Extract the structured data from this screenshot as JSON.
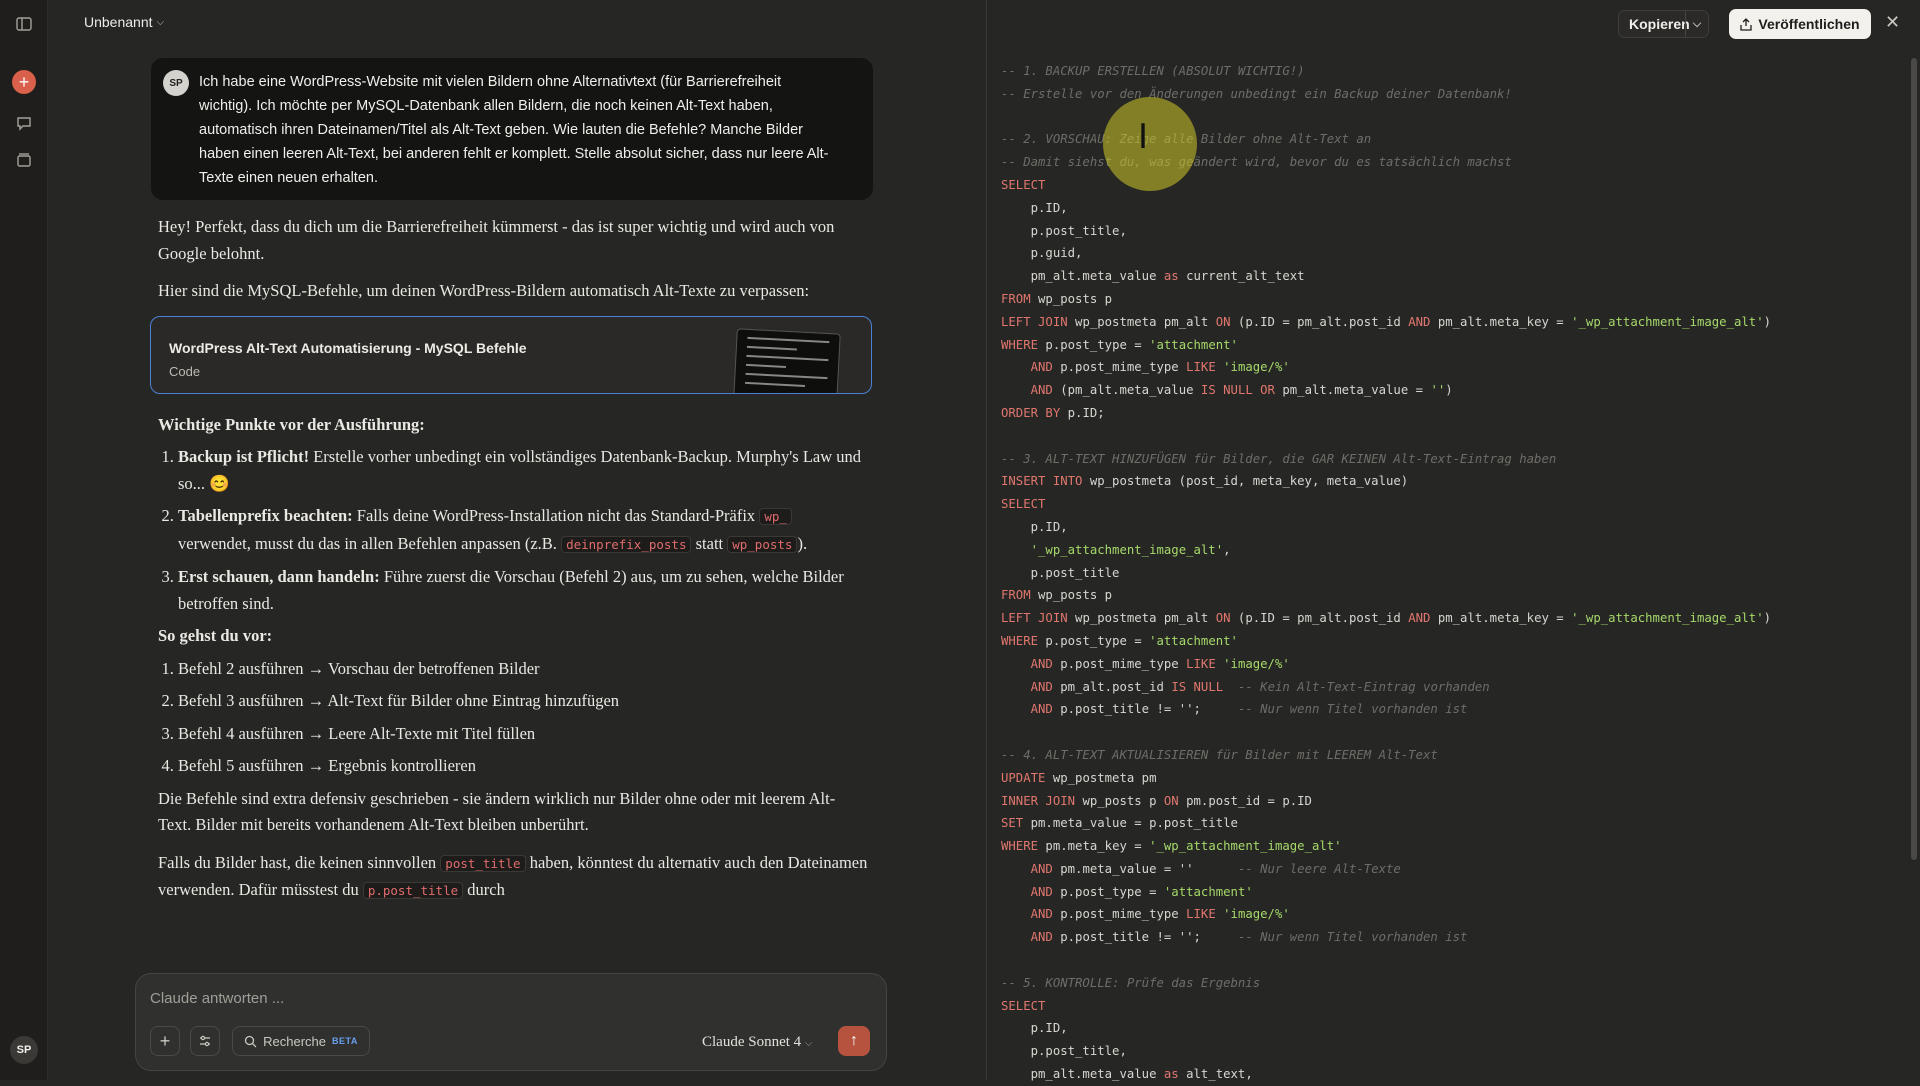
{
  "sidebar": {
    "icons": [
      "sidebar-toggle-icon",
      "new-chat-icon",
      "search-icon",
      "projects-icon"
    ],
    "avatar_initials": "SP"
  },
  "chat": {
    "title": "Unbenannt",
    "user": {
      "initials": "SP",
      "message": "Ich habe eine WordPress-Website mit vielen Bildern ohne Alternativtext (für Barrierefreiheit wichtig). Ich möchte per MySQL-Datenbank allen Bildern, die noch keinen Alt-Text haben, automatisch ihren Dateinamen/Titel als Alt-Text geben. Wie lauten die Befehle? Manche Bilder haben einen leeren Alt-Text, bei anderen fehlt er komplett. Stelle absolut sicher, dass nur leere Alt-Texte einen neuen erhalten."
    },
    "assistant": {
      "p1": "Hey! Perfekt, dass du dich um die Barrierefreiheit kümmerst - das ist super wichtig und wird auch von Google belohnt.",
      "p2": "Hier sind die MySQL-Befehle, um deinen WordPress-Bildern automatisch Alt-Texte zu verpassen:",
      "artifact": {
        "title": "WordPress Alt-Text Automatisierung - MySQL Befehle",
        "kind": "Code"
      },
      "h_points": "Wichtige Punkte vor der Ausführung:",
      "point1_strong": "Backup ist Pflicht!",
      "point1_text": " Erstelle vorher unbedingt ein vollständiges Datenbank-Backup. Murphy's Law und so... 😊",
      "point2_strong": "Tabellenprefix beachten:",
      "point2_a": " Falls deine WordPress-Installation nicht das Standard-Präfix ",
      "point2_code1": "wp_",
      "point2_b": " verwendet, musst du das in allen Befehlen anpassen (z.B. ",
      "point2_code2": "deinprefix_posts",
      "point2_c": " statt ",
      "point2_code3": "wp_posts",
      "point2_d": ").",
      "point3_strong": "Erst schauen, dann handeln:",
      "point3_text": " Führe zuerst die Vorschau (Befehl 2) aus, um zu sehen, welche Bilder betroffen sind.",
      "h_steps": "So gehst du vor:",
      "steps": [
        "Befehl 2 ausführen → Vorschau der betroffenen Bilder",
        "Befehl 3 ausführen → Alt-Text für Bilder ohne Eintrag hinzufügen",
        "Befehl 4 ausführen → Leere Alt-Texte mit Titel füllen",
        "Befehl 5 ausführen → Ergebnis kontrollieren"
      ],
      "p3": "Die Befehle sind extra defensiv geschrieben - sie ändern wirklich nur Bilder ohne oder mit leerem Alt-Text. Bilder mit bereits vorhandenem Alt-Text bleiben unberührt.",
      "p4_a": "Falls du Bilder hast, die keinen sinnvollen ",
      "p4_code1": "post_title",
      "p4_b": " haben, könntest du alternativ auch den Dateinamen verwenden. Dafür müsstest du ",
      "p4_code2": "p.post_title",
      "p4_c": " durch"
    }
  },
  "composer": {
    "placeholder": "Claude antworten ...",
    "research_label": "Recherche",
    "beta_label": "BETA",
    "model": "Claude Sonnet 4"
  },
  "panel": {
    "copy_label": "Kopieren",
    "publish_label": "Veröffentlichen",
    "code_lines": [
      [
        [
          "cm",
          "-- 1. BACKUP ERSTELLEN (ABSOLUT WICHTIG!)"
        ]
      ],
      [
        [
          "cm",
          "-- Erstelle vor den Änderungen unbedingt ein Backup deiner Datenbank!"
        ]
      ],
      [],
      [
        [
          "cm",
          "-- 2. VORSCHAU: Zeige alle Bilder ohne Alt-Text an"
        ]
      ],
      [
        [
          "cm",
          "-- Damit siehst du, was geändert wird, bevor du es tatsächlich machst"
        ]
      ],
      [
        [
          "kw",
          "SELECT"
        ]
      ],
      [
        [
          "",
          "    p.ID,"
        ]
      ],
      [
        [
          "",
          "    p.post_title,"
        ]
      ],
      [
        [
          "",
          "    p.guid,"
        ]
      ],
      [
        [
          "",
          "    pm_alt.meta_value "
        ],
        [
          "kw",
          "as"
        ],
        [
          "",
          " current_alt_text"
        ]
      ],
      [
        [
          "kw",
          "FROM"
        ],
        [
          "",
          " wp_posts p"
        ]
      ],
      [
        [
          "kw",
          "LEFT JOIN"
        ],
        [
          "",
          " wp_postmeta pm_alt "
        ],
        [
          "kw",
          "ON"
        ],
        [
          "",
          " (p.ID = pm_alt.post_id "
        ],
        [
          "kw",
          "AND"
        ],
        [
          "",
          " pm_alt.meta_key = "
        ],
        [
          "st",
          "'_wp_attachment_image_alt'"
        ],
        [
          "",
          ")"
        ]
      ],
      [
        [
          "kw",
          "WHERE"
        ],
        [
          "",
          " p.post_type = "
        ],
        [
          "st",
          "'attachment'"
        ]
      ],
      [
        [
          "",
          "    "
        ],
        [
          "kw",
          "AND"
        ],
        [
          "",
          " p.post_mime_type "
        ],
        [
          "kw",
          "LIKE"
        ],
        [
          "",
          " "
        ],
        [
          "st",
          "'image/%'"
        ]
      ],
      [
        [
          "",
          "    "
        ],
        [
          "kw",
          "AND"
        ],
        [
          "",
          " (pm_alt.meta_value "
        ],
        [
          "kw",
          "IS NULL OR"
        ],
        [
          "",
          " pm_alt.meta_value = "
        ],
        [
          "st",
          "''"
        ],
        [
          "",
          ")"
        ]
      ],
      [
        [
          "kw",
          "ORDER BY"
        ],
        [
          "",
          " p.ID;"
        ]
      ],
      [],
      [
        [
          "cm",
          "-- 3. ALT-TEXT HINZUFÜGEN für Bilder, die GAR KEINEN Alt-Text-Eintrag haben"
        ]
      ],
      [
        [
          "kw",
          "INSERT INTO"
        ],
        [
          "",
          " wp_postmeta (post_id, meta_key, meta_value)"
        ]
      ],
      [
        [
          "kw",
          "SELECT"
        ]
      ],
      [
        [
          "",
          "    p.ID,"
        ]
      ],
      [
        [
          "",
          "    "
        ],
        [
          "st",
          "'_wp_attachment_image_alt'"
        ],
        [
          "",
          ","
        ]
      ],
      [
        [
          "",
          "    p.post_title"
        ]
      ],
      [
        [
          "kw",
          "FROM"
        ],
        [
          "",
          " wp_posts p"
        ]
      ],
      [
        [
          "kw",
          "LEFT JOIN"
        ],
        [
          "",
          " wp_postmeta pm_alt "
        ],
        [
          "kw",
          "ON"
        ],
        [
          "",
          " (p.ID = pm_alt.post_id "
        ],
        [
          "kw",
          "AND"
        ],
        [
          "",
          " pm_alt.meta_key = "
        ],
        [
          "st",
          "'_wp_attachment_image_alt'"
        ],
        [
          "",
          ")"
        ]
      ],
      [
        [
          "kw",
          "WHERE"
        ],
        [
          "",
          " p.post_type = "
        ],
        [
          "st",
          "'attachment'"
        ]
      ],
      [
        [
          "",
          "    "
        ],
        [
          "kw",
          "AND"
        ],
        [
          "",
          " p.post_mime_type "
        ],
        [
          "kw",
          "LIKE"
        ],
        [
          "",
          " "
        ],
        [
          "st",
          "'image/%'"
        ]
      ],
      [
        [
          "",
          "    "
        ],
        [
          "kw",
          "AND"
        ],
        [
          "",
          " pm_alt.post_id "
        ],
        [
          "kw",
          "IS NULL"
        ],
        [
          "",
          "  "
        ],
        [
          "cm",
          "-- Kein Alt-Text-Eintrag vorhanden"
        ]
      ],
      [
        [
          "",
          "    "
        ],
        [
          "kw",
          "AND"
        ],
        [
          "",
          " p.post_title != '';     "
        ],
        [
          "cm",
          "-- Nur wenn Titel vorhanden ist"
        ]
      ],
      [],
      [
        [
          "cm",
          "-- 4. ALT-TEXT AKTUALISIEREN für Bilder mit LEEREM Alt-Text"
        ]
      ],
      [
        [
          "kw",
          "UPDATE"
        ],
        [
          "",
          " wp_postmeta pm"
        ]
      ],
      [
        [
          "kw",
          "INNER JOIN"
        ],
        [
          "",
          " wp_posts p "
        ],
        [
          "kw",
          "ON"
        ],
        [
          "",
          " pm.post_id = p.ID"
        ]
      ],
      [
        [
          "kw",
          "SET"
        ],
        [
          "",
          " pm.meta_value = p.post_title"
        ]
      ],
      [
        [
          "kw",
          "WHERE"
        ],
        [
          "",
          " pm.meta_key = "
        ],
        [
          "st",
          "'_wp_attachment_image_alt'"
        ]
      ],
      [
        [
          "",
          "    "
        ],
        [
          "kw",
          "AND"
        ],
        [
          "",
          " pm.meta_value = ''      "
        ],
        [
          "cm",
          "-- Nur leere Alt-Texte"
        ]
      ],
      [
        [
          "",
          "    "
        ],
        [
          "kw",
          "AND"
        ],
        [
          "",
          " p.post_type = "
        ],
        [
          "st",
          "'attachment'"
        ]
      ],
      [
        [
          "",
          "    "
        ],
        [
          "kw",
          "AND"
        ],
        [
          "",
          " p.post_mime_type "
        ],
        [
          "kw",
          "LIKE"
        ],
        [
          "",
          " "
        ],
        [
          "st",
          "'image/%'"
        ]
      ],
      [
        [
          "",
          "    "
        ],
        [
          "kw",
          "AND"
        ],
        [
          "",
          " p.post_title != '';     "
        ],
        [
          "cm",
          "-- Nur wenn Titel vorhanden ist"
        ]
      ],
      [],
      [
        [
          "cm",
          "-- 5. KONTROLLE: Prüfe das Ergebnis"
        ]
      ],
      [
        [
          "kw",
          "SELECT"
        ]
      ],
      [
        [
          "",
          "    p.ID,"
        ]
      ],
      [
        [
          "",
          "    p.post_title,"
        ]
      ],
      [
        [
          "",
          "    pm_alt.meta_value "
        ],
        [
          "kw",
          "as"
        ],
        [
          "",
          " alt_text,"
        ]
      ]
    ]
  }
}
